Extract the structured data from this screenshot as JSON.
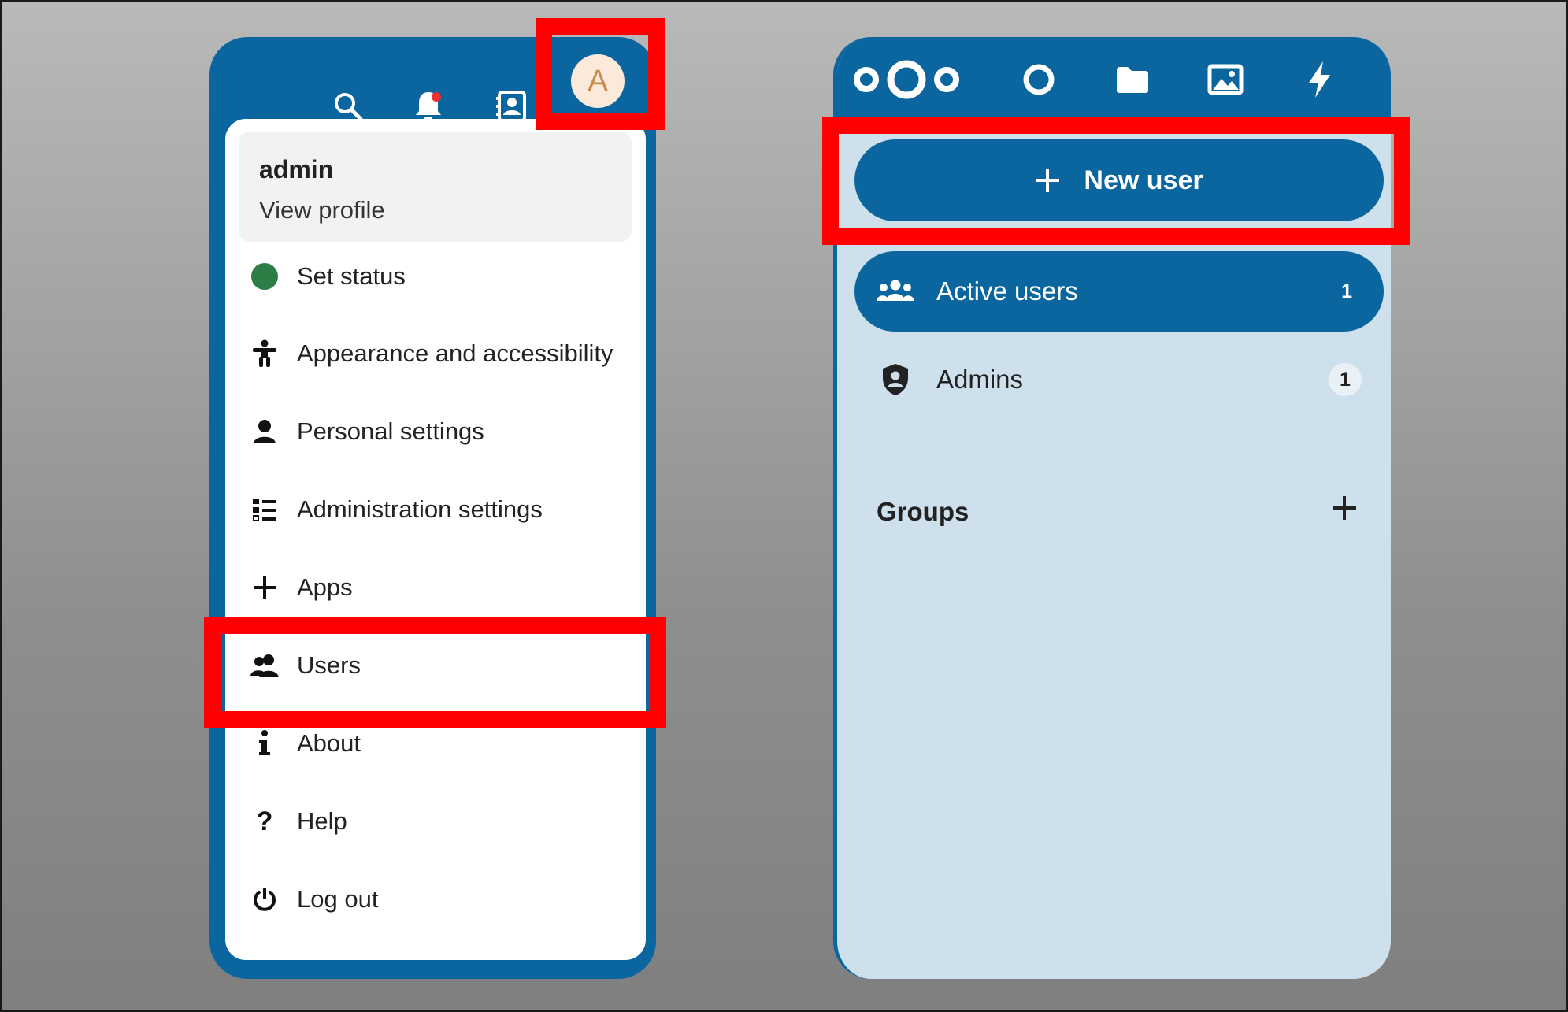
{
  "header": {
    "icons": [
      "search-icon",
      "notifications-bell-icon",
      "contacts-icon"
    ],
    "avatar_initial": "A"
  },
  "user_menu": {
    "profile": {
      "name": "admin",
      "link": "View profile"
    },
    "items": [
      {
        "label": "Set status",
        "icon": "status-dot-icon",
        "status_color": "#2d7d46"
      },
      {
        "label": "Appearance and accessibility",
        "icon": "accessibility-icon"
      },
      {
        "label": "Personal settings",
        "icon": "person-icon"
      },
      {
        "label": "Administration settings",
        "icon": "list-settings-icon"
      },
      {
        "label": "Apps",
        "icon": "plus-icon"
      },
      {
        "label": "Users",
        "icon": "users-icon"
      },
      {
        "label": "About",
        "icon": "info-icon"
      },
      {
        "label": "Help",
        "icon": "question-icon"
      },
      {
        "label": "Log out",
        "icon": "power-icon"
      }
    ]
  },
  "users_app": {
    "nav_icons": [
      "nextcloud-logo-icon",
      "dashboard-circle-icon",
      "files-folder-icon",
      "photos-image-icon",
      "activity-bolt-icon"
    ],
    "new_user_label": "New user",
    "groups_list": [
      {
        "label": "Active users",
        "count": "1",
        "active": true
      },
      {
        "label": "Admins",
        "count": "1",
        "active": false
      }
    ],
    "groups_caption": "Groups"
  },
  "colors": {
    "brand": "#0b66a0",
    "highlight": "#ff0000",
    "panel_background": "#cde0ec",
    "avatar_background": "#fbe9da",
    "notification_dot": "#e9322d"
  }
}
